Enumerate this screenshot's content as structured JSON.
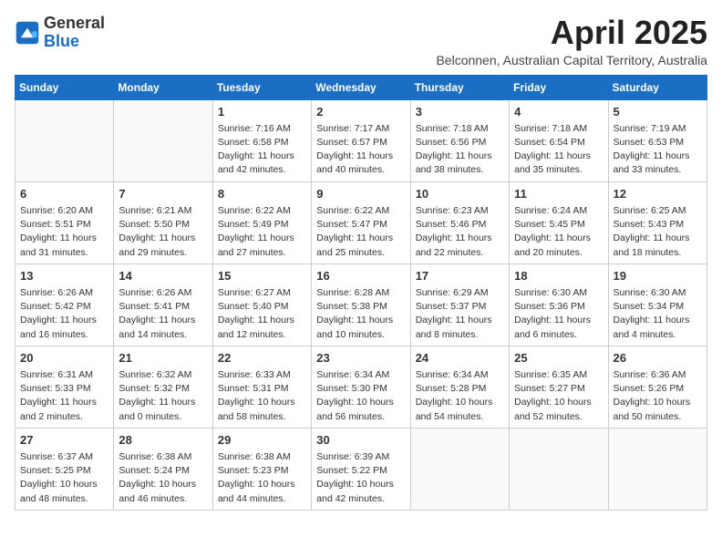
{
  "header": {
    "logo_general": "General",
    "logo_blue": "Blue",
    "month_title": "April 2025",
    "subtitle": "Belconnen, Australian Capital Territory, Australia"
  },
  "days_of_week": [
    "Sunday",
    "Monday",
    "Tuesday",
    "Wednesday",
    "Thursday",
    "Friday",
    "Saturday"
  ],
  "weeks": [
    [
      {
        "day": "",
        "info": ""
      },
      {
        "day": "",
        "info": ""
      },
      {
        "day": "1",
        "info": "Sunrise: 7:16 AM\nSunset: 6:58 PM\nDaylight: 11 hours and 42 minutes."
      },
      {
        "day": "2",
        "info": "Sunrise: 7:17 AM\nSunset: 6:57 PM\nDaylight: 11 hours and 40 minutes."
      },
      {
        "day": "3",
        "info": "Sunrise: 7:18 AM\nSunset: 6:56 PM\nDaylight: 11 hours and 38 minutes."
      },
      {
        "day": "4",
        "info": "Sunrise: 7:18 AM\nSunset: 6:54 PM\nDaylight: 11 hours and 35 minutes."
      },
      {
        "day": "5",
        "info": "Sunrise: 7:19 AM\nSunset: 6:53 PM\nDaylight: 11 hours and 33 minutes."
      }
    ],
    [
      {
        "day": "6",
        "info": "Sunrise: 6:20 AM\nSunset: 5:51 PM\nDaylight: 11 hours and 31 minutes."
      },
      {
        "day": "7",
        "info": "Sunrise: 6:21 AM\nSunset: 5:50 PM\nDaylight: 11 hours and 29 minutes."
      },
      {
        "day": "8",
        "info": "Sunrise: 6:22 AM\nSunset: 5:49 PM\nDaylight: 11 hours and 27 minutes."
      },
      {
        "day": "9",
        "info": "Sunrise: 6:22 AM\nSunset: 5:47 PM\nDaylight: 11 hours and 25 minutes."
      },
      {
        "day": "10",
        "info": "Sunrise: 6:23 AM\nSunset: 5:46 PM\nDaylight: 11 hours and 22 minutes."
      },
      {
        "day": "11",
        "info": "Sunrise: 6:24 AM\nSunset: 5:45 PM\nDaylight: 11 hours and 20 minutes."
      },
      {
        "day": "12",
        "info": "Sunrise: 6:25 AM\nSunset: 5:43 PM\nDaylight: 11 hours and 18 minutes."
      }
    ],
    [
      {
        "day": "13",
        "info": "Sunrise: 6:26 AM\nSunset: 5:42 PM\nDaylight: 11 hours and 16 minutes."
      },
      {
        "day": "14",
        "info": "Sunrise: 6:26 AM\nSunset: 5:41 PM\nDaylight: 11 hours and 14 minutes."
      },
      {
        "day": "15",
        "info": "Sunrise: 6:27 AM\nSunset: 5:40 PM\nDaylight: 11 hours and 12 minutes."
      },
      {
        "day": "16",
        "info": "Sunrise: 6:28 AM\nSunset: 5:38 PM\nDaylight: 11 hours and 10 minutes."
      },
      {
        "day": "17",
        "info": "Sunrise: 6:29 AM\nSunset: 5:37 PM\nDaylight: 11 hours and 8 minutes."
      },
      {
        "day": "18",
        "info": "Sunrise: 6:30 AM\nSunset: 5:36 PM\nDaylight: 11 hours and 6 minutes."
      },
      {
        "day": "19",
        "info": "Sunrise: 6:30 AM\nSunset: 5:34 PM\nDaylight: 11 hours and 4 minutes."
      }
    ],
    [
      {
        "day": "20",
        "info": "Sunrise: 6:31 AM\nSunset: 5:33 PM\nDaylight: 11 hours and 2 minutes."
      },
      {
        "day": "21",
        "info": "Sunrise: 6:32 AM\nSunset: 5:32 PM\nDaylight: 11 hours and 0 minutes."
      },
      {
        "day": "22",
        "info": "Sunrise: 6:33 AM\nSunset: 5:31 PM\nDaylight: 10 hours and 58 minutes."
      },
      {
        "day": "23",
        "info": "Sunrise: 6:34 AM\nSunset: 5:30 PM\nDaylight: 10 hours and 56 minutes."
      },
      {
        "day": "24",
        "info": "Sunrise: 6:34 AM\nSunset: 5:28 PM\nDaylight: 10 hours and 54 minutes."
      },
      {
        "day": "25",
        "info": "Sunrise: 6:35 AM\nSunset: 5:27 PM\nDaylight: 10 hours and 52 minutes."
      },
      {
        "day": "26",
        "info": "Sunrise: 6:36 AM\nSunset: 5:26 PM\nDaylight: 10 hours and 50 minutes."
      }
    ],
    [
      {
        "day": "27",
        "info": "Sunrise: 6:37 AM\nSunset: 5:25 PM\nDaylight: 10 hours and 48 minutes."
      },
      {
        "day": "28",
        "info": "Sunrise: 6:38 AM\nSunset: 5:24 PM\nDaylight: 10 hours and 46 minutes."
      },
      {
        "day": "29",
        "info": "Sunrise: 6:38 AM\nSunset: 5:23 PM\nDaylight: 10 hours and 44 minutes."
      },
      {
        "day": "30",
        "info": "Sunrise: 6:39 AM\nSunset: 5:22 PM\nDaylight: 10 hours and 42 minutes."
      },
      {
        "day": "",
        "info": ""
      },
      {
        "day": "",
        "info": ""
      },
      {
        "day": "",
        "info": ""
      }
    ]
  ]
}
